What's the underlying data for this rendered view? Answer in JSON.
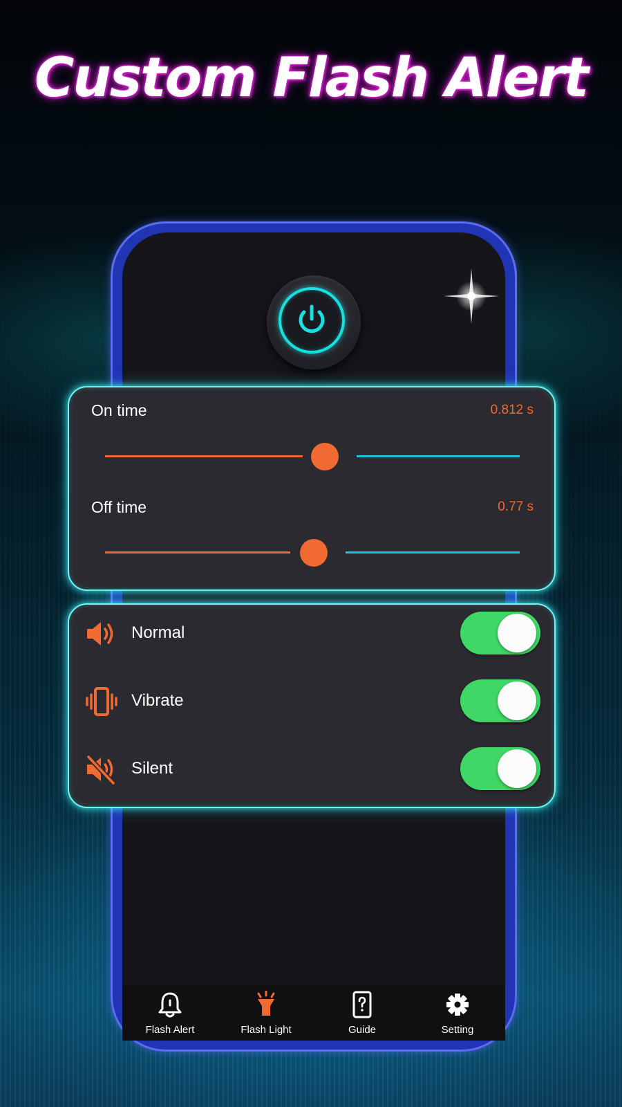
{
  "promo": {
    "headline": "Custom Flash Alert"
  },
  "power_button": {
    "icon": "power-icon",
    "state": "on"
  },
  "timing": {
    "on_time": {
      "label": "On time",
      "value": "0.812 s",
      "slider_fraction": 0.54
    },
    "off_time": {
      "label": "Off time",
      "value": "0.77 s",
      "slider_fraction": 0.51
    }
  },
  "modes": [
    {
      "label": "Normal",
      "icon": "speaker-icon",
      "enabled": true
    },
    {
      "label": "Vibrate",
      "icon": "vibrate-icon",
      "enabled": true
    },
    {
      "label": "Silent",
      "icon": "mute-icon",
      "enabled": true
    }
  ],
  "nav": {
    "items": [
      {
        "label": "Flash Alert",
        "icon": "bell-icon",
        "active": false
      },
      {
        "label": "Flash Light",
        "icon": "flashlight-icon",
        "active": true
      },
      {
        "label": "Guide",
        "icon": "guide-icon",
        "active": false
      },
      {
        "label": "Setting",
        "icon": "gear-icon",
        "active": false
      }
    ]
  },
  "colors": {
    "accent_orange": "#f06a32",
    "accent_cyan": "#1ec4d4",
    "toggle_on": "#3fd765",
    "card_border": "#6ef4f4",
    "headline_glow": "#d01fc8"
  }
}
